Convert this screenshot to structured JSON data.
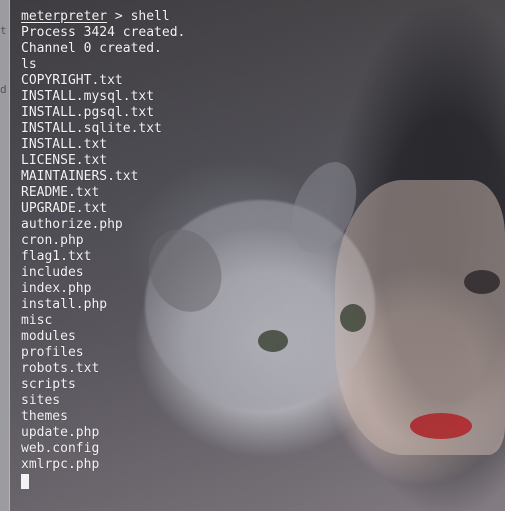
{
  "terminal": {
    "prompt_name": "meterpreter",
    "prompt_rest": " > shell",
    "lines": [
      "Process 3424 created.",
      "Channel 0 created.",
      "ls",
      "COPYRIGHT.txt",
      "INSTALL.mysql.txt",
      "INSTALL.pgsql.txt",
      "INSTALL.sqlite.txt",
      "INSTALL.txt",
      "LICENSE.txt",
      "MAINTAINERS.txt",
      "README.txt",
      "UPGRADE.txt",
      "authorize.php",
      "cron.php",
      "flag1.txt",
      "includes",
      "index.php",
      "install.php",
      "misc",
      "modules",
      "profiles",
      "robots.txt",
      "scripts",
      "sites",
      "themes",
      "update.php",
      "web.config",
      "xmlrpc.php"
    ]
  },
  "side_glyphs": [
    "t",
    "d"
  ],
  "icons": {
    "cursor": "terminal-cursor-icon"
  },
  "colors": {
    "text": "#f3f3f3",
    "lips": "#bd2a2f",
    "strip": "#cfcfd3"
  }
}
